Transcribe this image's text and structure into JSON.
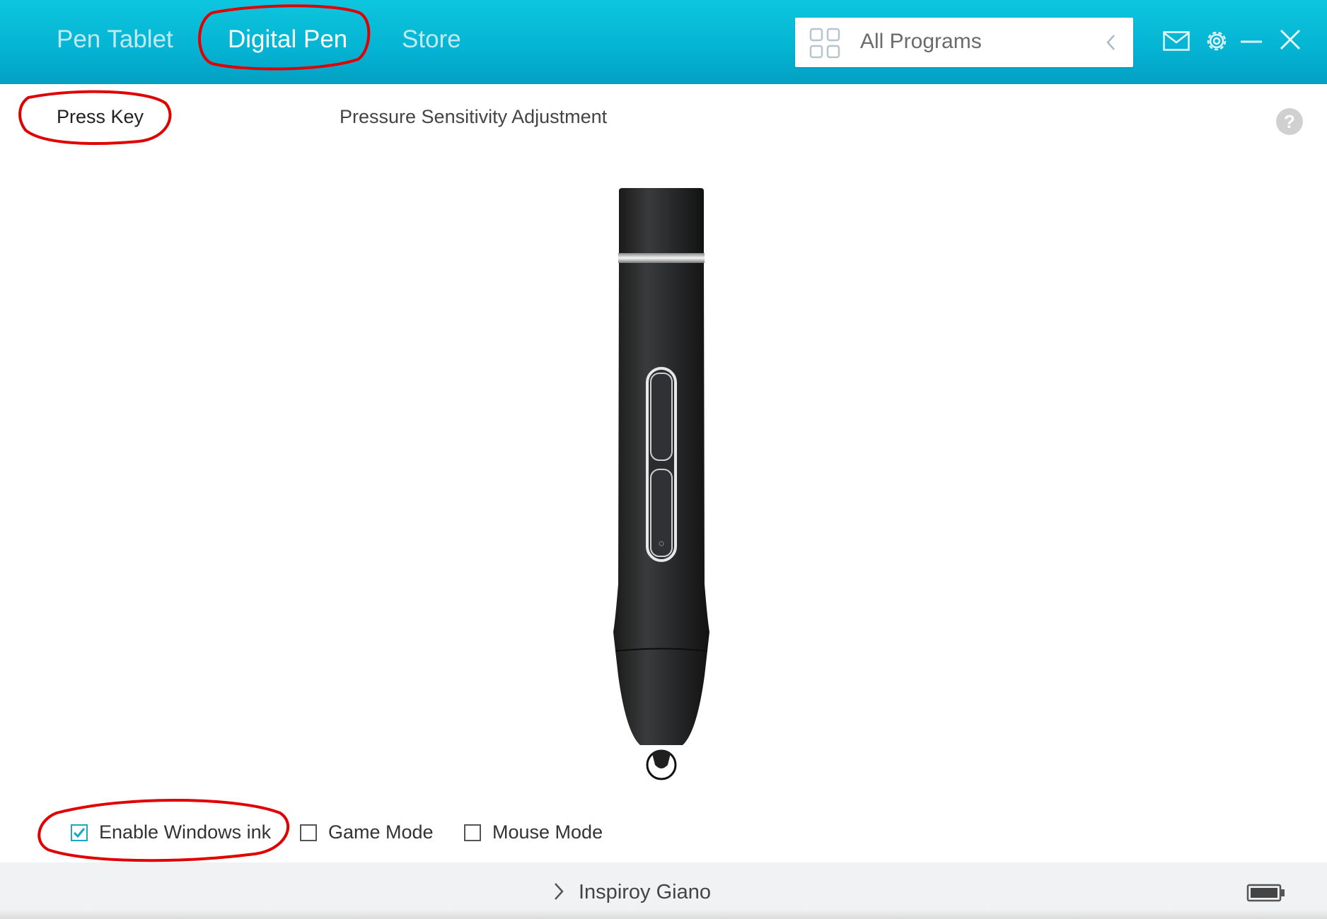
{
  "header": {
    "tabs": [
      {
        "label": "Pen Tablet",
        "active": false
      },
      {
        "label": "Digital Pen",
        "active": true
      },
      {
        "label": "Store",
        "active": false
      }
    ],
    "program_selector": {
      "label": "All Programs",
      "icon": "grid-icon",
      "toggle_icon": "chevron-left-icon"
    },
    "window_icons": [
      "mail-icon",
      "gear-icon",
      "minimize-icon",
      "close-icon"
    ]
  },
  "subtabs": [
    {
      "label": "Press Key",
      "active": true
    },
    {
      "label": "Pressure Sensitivity Adjustment",
      "active": false
    }
  ],
  "help": {
    "label": "?"
  },
  "options": [
    {
      "label": "Enable Windows ink",
      "checked": true
    },
    {
      "label": "Game Mode",
      "checked": false
    },
    {
      "label": "Mouse Mode",
      "checked": false
    }
  ],
  "footer": {
    "device_name": "Inspiroy Giano",
    "device_icon": "chevron-right-icon",
    "status_icon": "battery-icon"
  },
  "colors": {
    "header": "#05b5d3",
    "accent": "#1aa7c4",
    "annotation": "#e00000"
  }
}
